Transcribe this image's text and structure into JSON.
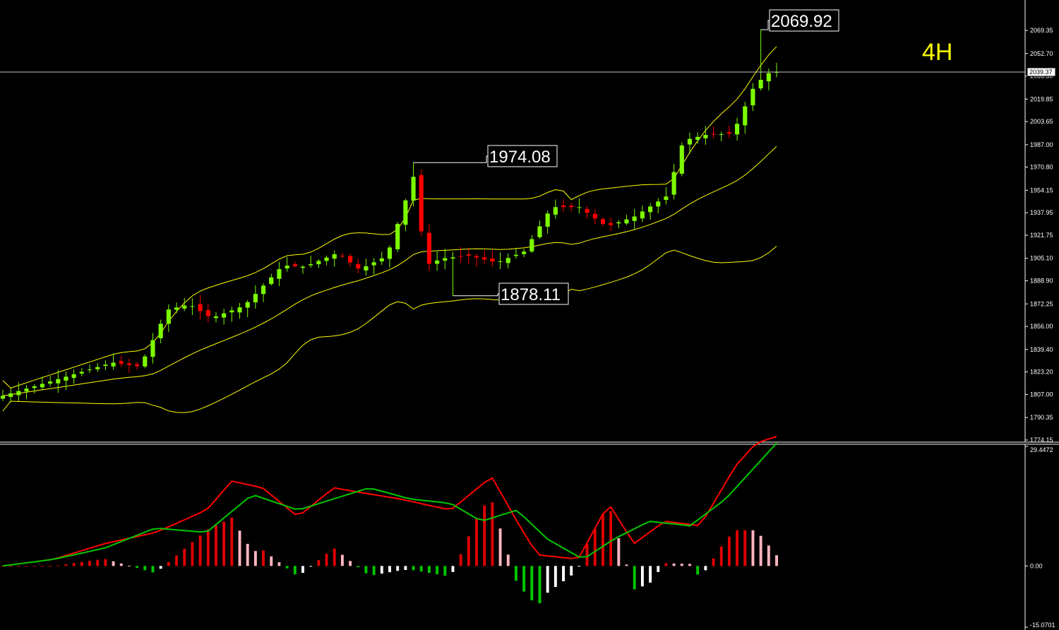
{
  "timeframe_label": "4H",
  "colors": {
    "background": "#000000",
    "bull_candle": "#7cfc00",
    "bear_candle": "#ff0000",
    "bollinger": "#ffff00",
    "price_line": "#c0c0c0",
    "axis_text": "#ffffff",
    "timeframe_label": "#ffff00",
    "macd_line": "#ff0000",
    "signal_line": "#00c800",
    "hist_pos_rising": "#e00000",
    "hist_pos_falling": "#ffb6c1",
    "hist_neg_falling": "#00c800",
    "hist_neg_rising": "#ffffff"
  },
  "price_panel": {
    "ylim": [
      1774.15,
      2076.0
    ],
    "y_ticks": [
      "2069.35",
      "2052.70",
      "2036.50",
      "2019.85",
      "2003.65",
      "1987.00",
      "1970.80",
      "1954.15",
      "1937.95",
      "1921.75",
      "1905.10",
      "1888.90",
      "1872.25",
      "1856.00",
      "1839.40",
      "1823.20",
      "1807.00",
      "1790.35",
      "1774.15"
    ],
    "current_price": "2039.37",
    "annotations": [
      "2069.92",
      "1974.08",
      "1878.11"
    ]
  },
  "indicator_panel": {
    "ylim": [
      -15.0701,
      29.4472
    ],
    "y_ticks": [
      "29.4472",
      "0.00",
      "-15.0701"
    ]
  },
  "chart_data": {
    "type": "candlestick",
    "title": "",
    "timeframe": "4H",
    "n_bars": 99,
    "last_price": 2039.37,
    "high_label": 2069.92,
    "swing_high_label": 1974.08,
    "swing_low_label": 1878.11,
    "trend_anchors_close": [
      [
        0,
        1806
      ],
      [
        10,
        1818
      ],
      [
        20,
        1830
      ],
      [
        25,
        1827
      ],
      [
        30,
        1868
      ],
      [
        34,
        1872
      ],
      [
        38,
        1862
      ],
      [
        44,
        1871
      ],
      [
        51,
        1900
      ],
      [
        55,
        1899
      ],
      [
        61,
        1909
      ],
      [
        65,
        1897
      ],
      [
        70,
        1907
      ],
      [
        75,
        1966
      ],
      [
        77,
        1900
      ],
      [
        80,
        1905
      ],
      [
        85,
        1907
      ],
      [
        90,
        1902
      ],
      [
        95,
        1910
      ],
      [
        100,
        1942
      ],
      [
        105,
        1942
      ],
      [
        110,
        1928
      ],
      [
        115,
        1935
      ],
      [
        121,
        1950
      ],
      [
        124,
        1990
      ],
      [
        128,
        1994
      ],
      [
        133,
        1995
      ],
      [
        137,
        2030
      ],
      [
        140,
        2040
      ],
      [
        141,
        2039.37
      ]
    ],
    "series_indicator": [
      {
        "name": "",
        "anchors": [
          [
            0,
            0
          ],
          [
            10,
            3
          ],
          [
            20,
            10
          ],
          [
            30,
            15
          ],
          [
            40,
            25
          ],
          [
            45,
            38
          ],
          [
            51,
            35
          ],
          [
            58,
            22
          ],
          [
            65,
            35
          ],
          [
            70,
            33
          ],
          [
            78,
            30
          ],
          [
            88,
            25
          ],
          [
            96,
            40
          ],
          [
            101,
            20
          ],
          [
            105,
            5
          ],
          [
            113,
            3
          ],
          [
            119,
            28
          ],
          [
            124,
            10
          ],
          [
            130,
            20
          ],
          [
            137,
            18
          ],
          [
            144,
            45
          ],
          [
            148,
            55
          ],
          [
            152,
            58
          ]
        ]
      },
      {
        "name": "",
        "anchors": [
          [
            0,
            0
          ],
          [
            10,
            3
          ],
          [
            20,
            8
          ],
          [
            30,
            17
          ],
          [
            40,
            15
          ],
          [
            49,
            32
          ],
          [
            58,
            25
          ],
          [
            65,
            30
          ],
          [
            72,
            35
          ],
          [
            80,
            30
          ],
          [
            88,
            28
          ],
          [
            94,
            20
          ],
          [
            101,
            25
          ],
          [
            107,
            12
          ],
          [
            114,
            3
          ],
          [
            120,
            12
          ],
          [
            127,
            20
          ],
          [
            135,
            18
          ],
          [
            142,
            30
          ],
          [
            152,
            55
          ]
        ]
      }
    ]
  }
}
